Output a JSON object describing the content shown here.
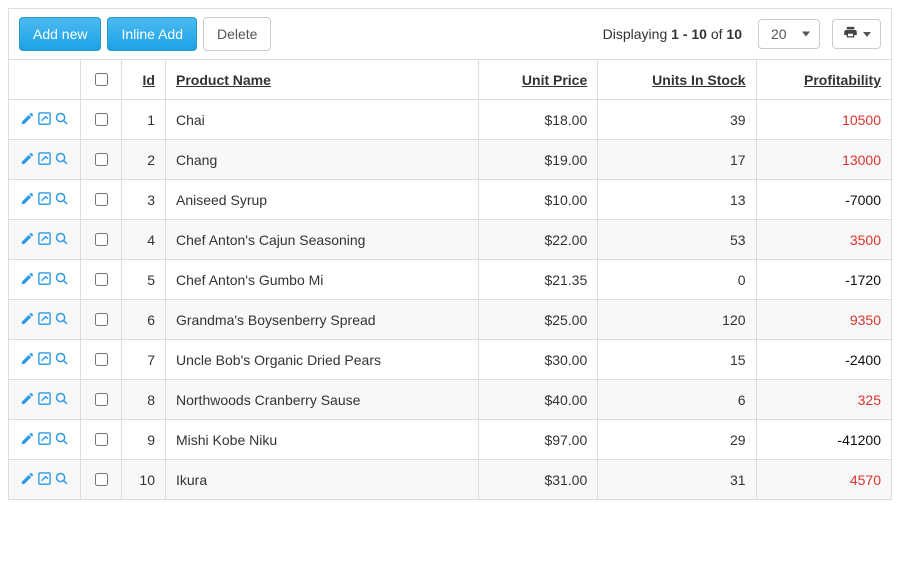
{
  "toolbar": {
    "add_new_label": "Add new",
    "inline_add_label": "Inline Add",
    "delete_label": "Delete",
    "display_prefix": "Displaying ",
    "display_range": "1 - 10",
    "display_of": " of ",
    "display_total": "10",
    "page_size": "20"
  },
  "columns": {
    "id": "Id",
    "name": "Product Name",
    "price": "Unit Price",
    "stock": "Units In Stock",
    "profit": "Profitability"
  },
  "rows": [
    {
      "id": "1",
      "name": "Chai",
      "price": "$18.00",
      "stock": "39",
      "profit": "10500",
      "profit_positive": true
    },
    {
      "id": "2",
      "name": "Chang",
      "price": "$19.00",
      "stock": "17",
      "profit": "13000",
      "profit_positive": true
    },
    {
      "id": "3",
      "name": "Aniseed Syrup",
      "price": "$10.00",
      "stock": "13",
      "profit": "-7000",
      "profit_positive": false
    },
    {
      "id": "4",
      "name": "Chef Anton's Cajun Seasoning",
      "price": "$22.00",
      "stock": "53",
      "profit": "3500",
      "profit_positive": true
    },
    {
      "id": "5",
      "name": "Chef Anton's Gumbo Mi",
      "price": "$21.35",
      "stock": "0",
      "profit": "-1720",
      "profit_positive": false
    },
    {
      "id": "6",
      "name": "Grandma's Boysenberry Spread",
      "price": "$25.00",
      "stock": "120",
      "profit": "9350",
      "profit_positive": true
    },
    {
      "id": "7",
      "name": "Uncle Bob's Organic Dried Pears",
      "price": "$30.00",
      "stock": "15",
      "profit": "-2400",
      "profit_positive": false
    },
    {
      "id": "8",
      "name": "Northwoods Cranberry Sause",
      "price": "$40.00",
      "stock": "6",
      "profit": "325",
      "profit_positive": true
    },
    {
      "id": "9",
      "name": "Mishi Kobe Niku",
      "price": "$97.00",
      "stock": "29",
      "profit": "-41200",
      "profit_positive": false
    },
    {
      "id": "10",
      "name": "Ikura",
      "price": "$31.00",
      "stock": "31",
      "profit": "4570",
      "profit_positive": true
    }
  ]
}
